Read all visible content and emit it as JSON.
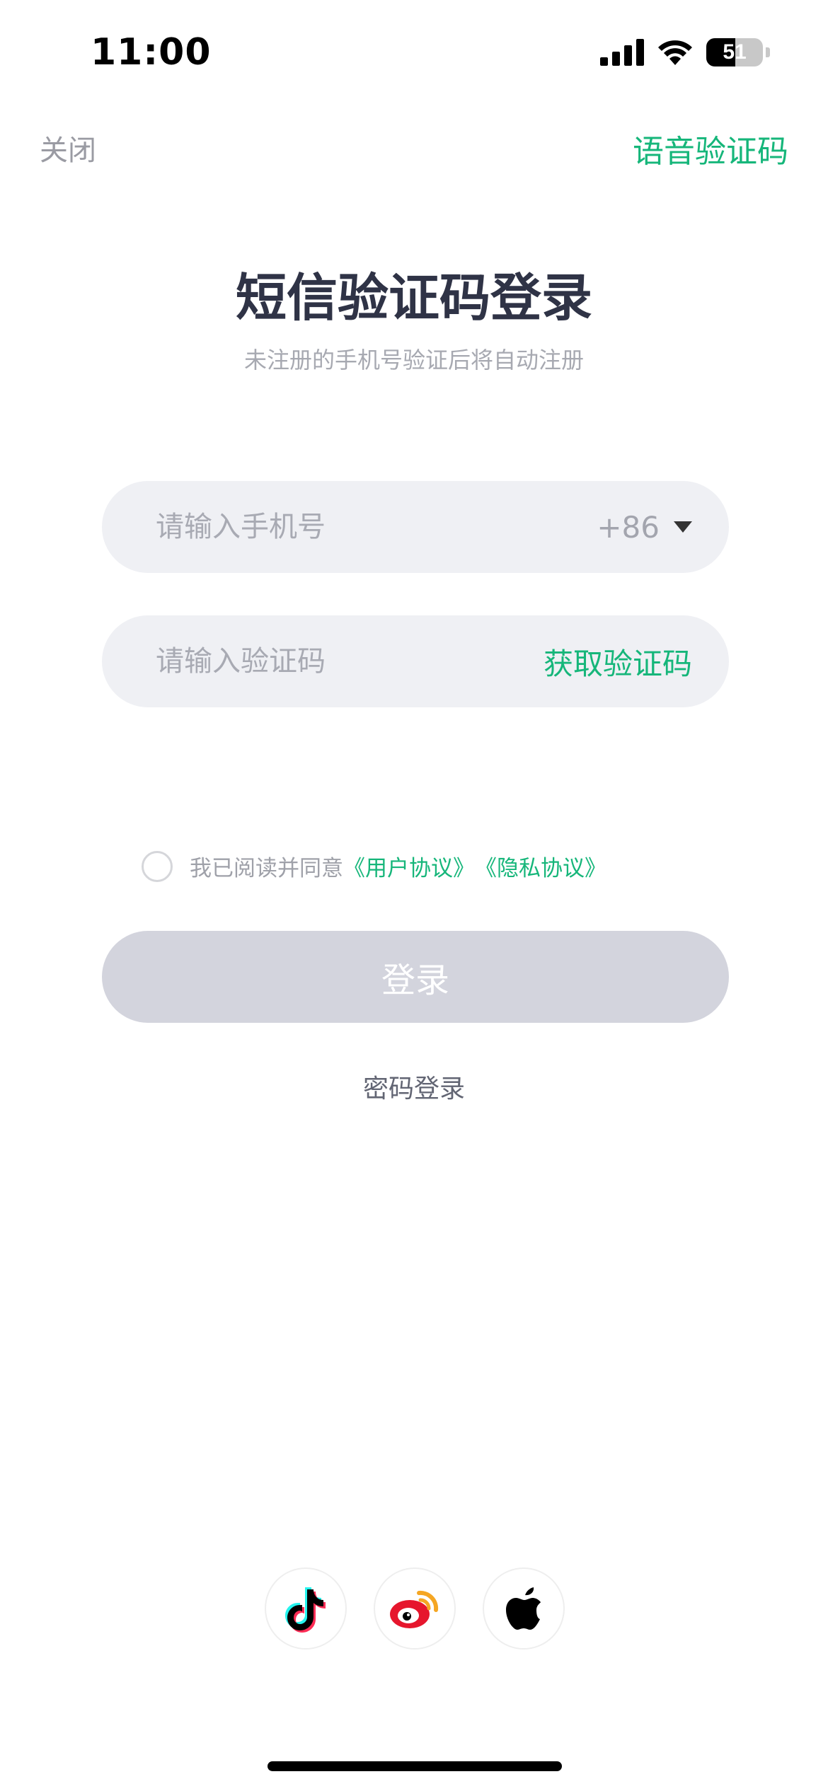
{
  "status_bar": {
    "time": "11:00",
    "battery_level": "51",
    "icons": [
      "cellular-signal-icon",
      "wifi-icon",
      "battery-icon"
    ]
  },
  "nav": {
    "close_label": "关闭",
    "voice_code_label": "语音验证码"
  },
  "header": {
    "title": "短信验证码登录",
    "subtitle": "未注册的手机号验证后将自动注册"
  },
  "phone_input": {
    "placeholder": "请输入手机号",
    "value": "",
    "country_code": "+86"
  },
  "code_input": {
    "placeholder": "请输入验证码",
    "value": "",
    "get_code_label": "获取验证码"
  },
  "agreement": {
    "checked": false,
    "prefix": "我已阅读并同意",
    "user_agreement": "《用户协议》",
    "privacy_policy": "《隐私协议》"
  },
  "login": {
    "label": "登录"
  },
  "password_login_label": "密码登录",
  "social_logins": [
    "tiktok-icon",
    "weibo-icon",
    "apple-icon"
  ],
  "colors": {
    "accent": "#16b67a",
    "title": "#2f3346",
    "input_bg": "#eff0f4",
    "button_disabled": "#d3d4dd"
  }
}
